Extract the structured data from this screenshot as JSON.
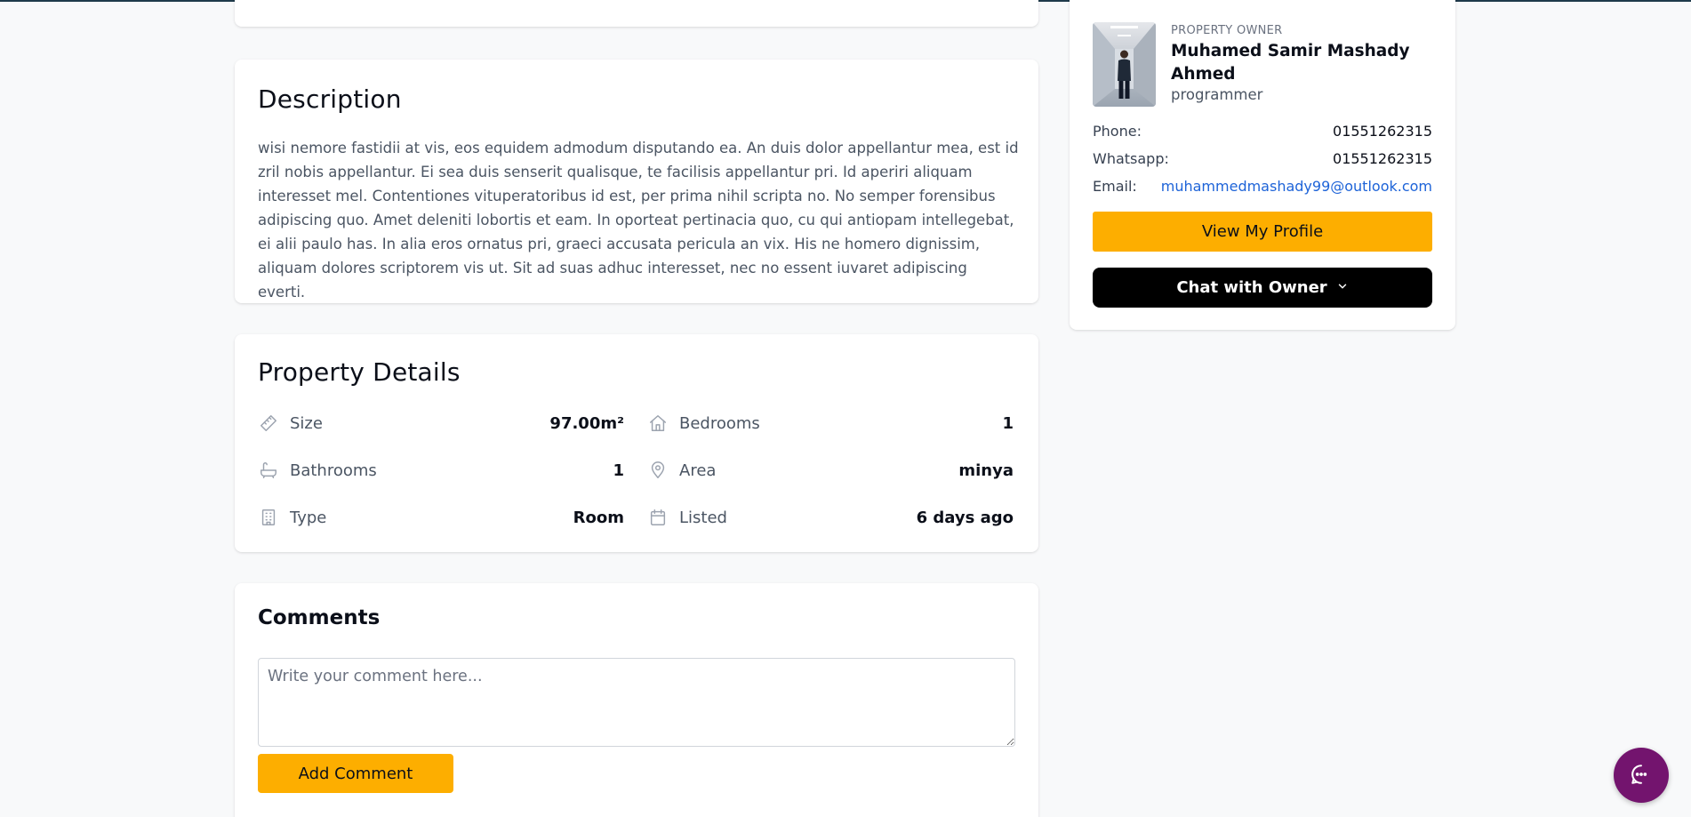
{
  "description": {
    "title": "Description",
    "text": "wisi nemore fastidii at vis, eos equidem admodum disputando ea. An duis dolor appellantur mea, est id zril nobis appellantur. Ei sea duis senserit qualisque, te facilisis appellantur pri. Id aperiri aliquam interesset mel. Contentiones vituperatoribus id est, per prima nihil scripta no. No semper forensibus adipiscing quo. Amet deleniti lobortis et eam. In oporteat pertinacia quo, cu qui antiopam intellegebat, ei alii paulo has. In alia eros ornatus pri, graeci accusata pericula an vix. His ne homero dignissim, aliquam dolores scriptorem vis ut. Sit ad suas adhuc interesset, nec no essent iuvaret adipiscing everti."
  },
  "details": {
    "title": "Property Details",
    "items": [
      {
        "label": "Size",
        "value": "97.00m²",
        "icon": "ruler-icon"
      },
      {
        "label": "Bedrooms",
        "value": "1",
        "icon": "home-icon"
      },
      {
        "label": "Bathrooms",
        "value": "1",
        "icon": "bathtub-icon"
      },
      {
        "label": "Area",
        "value": "minya",
        "icon": "location-pin-icon"
      },
      {
        "label": "Type",
        "value": "Room",
        "icon": "building-icon"
      },
      {
        "label": "Listed",
        "value": "6 days ago",
        "icon": "calendar-icon"
      }
    ]
  },
  "comments": {
    "title": "Comments",
    "placeholder": "Write your comment here...",
    "add_label": "Add Comment"
  },
  "owner": {
    "eyebrow": "PROPERTY OWNER",
    "name": "Muhamed Samir Mashady Ahmed",
    "role": "programmer",
    "phone_label": "Phone:",
    "phone": "01551262315",
    "whatsapp_label": "Whatsapp:",
    "whatsapp": "01551262315",
    "email_label": "Email:",
    "email": "muhammedmashady99@outlook.com",
    "profile_button": "View My Profile",
    "chat_button": "Chat with Owner"
  },
  "colors": {
    "accent": "#fdae00",
    "fab": "#73146e",
    "link": "#1d63d8"
  }
}
